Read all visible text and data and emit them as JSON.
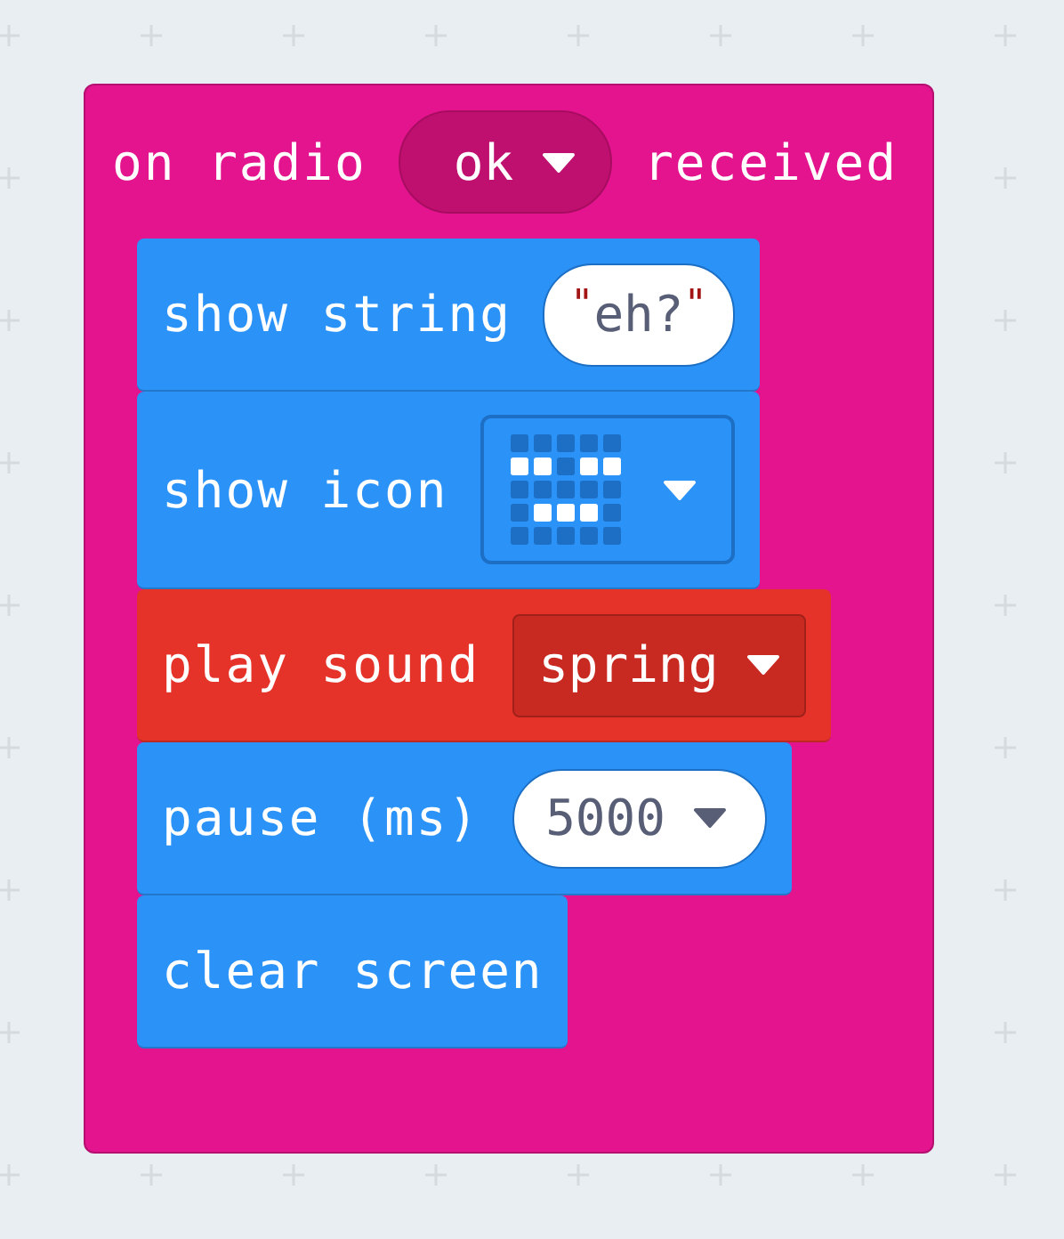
{
  "event": {
    "color": "#e3148e",
    "label_before": "on radio",
    "dropdown": {
      "value": "ok"
    },
    "label_after": "received"
  },
  "statements": [
    {
      "kind": "string",
      "color": "#2b93f7",
      "label": "show string",
      "open_quote": "\"",
      "value": "eh?",
      "close_quote": "\""
    },
    {
      "kind": "icon",
      "color": "#2b93f7",
      "label": "show icon",
      "leds": [
        [
          false,
          false,
          false,
          false,
          false
        ],
        [
          true,
          true,
          false,
          true,
          true
        ],
        [
          false,
          false,
          false,
          false,
          false
        ],
        [
          false,
          true,
          true,
          true,
          false
        ],
        [
          false,
          false,
          false,
          false,
          false
        ]
      ]
    },
    {
      "kind": "dropdown",
      "color": "#e5332a",
      "label": "play sound",
      "value": "spring"
    },
    {
      "kind": "number",
      "color": "#2b93f7",
      "label": "pause (ms)",
      "value": "5000"
    },
    {
      "kind": "plain",
      "color": "#2b93f7",
      "label": "clear screen"
    }
  ]
}
